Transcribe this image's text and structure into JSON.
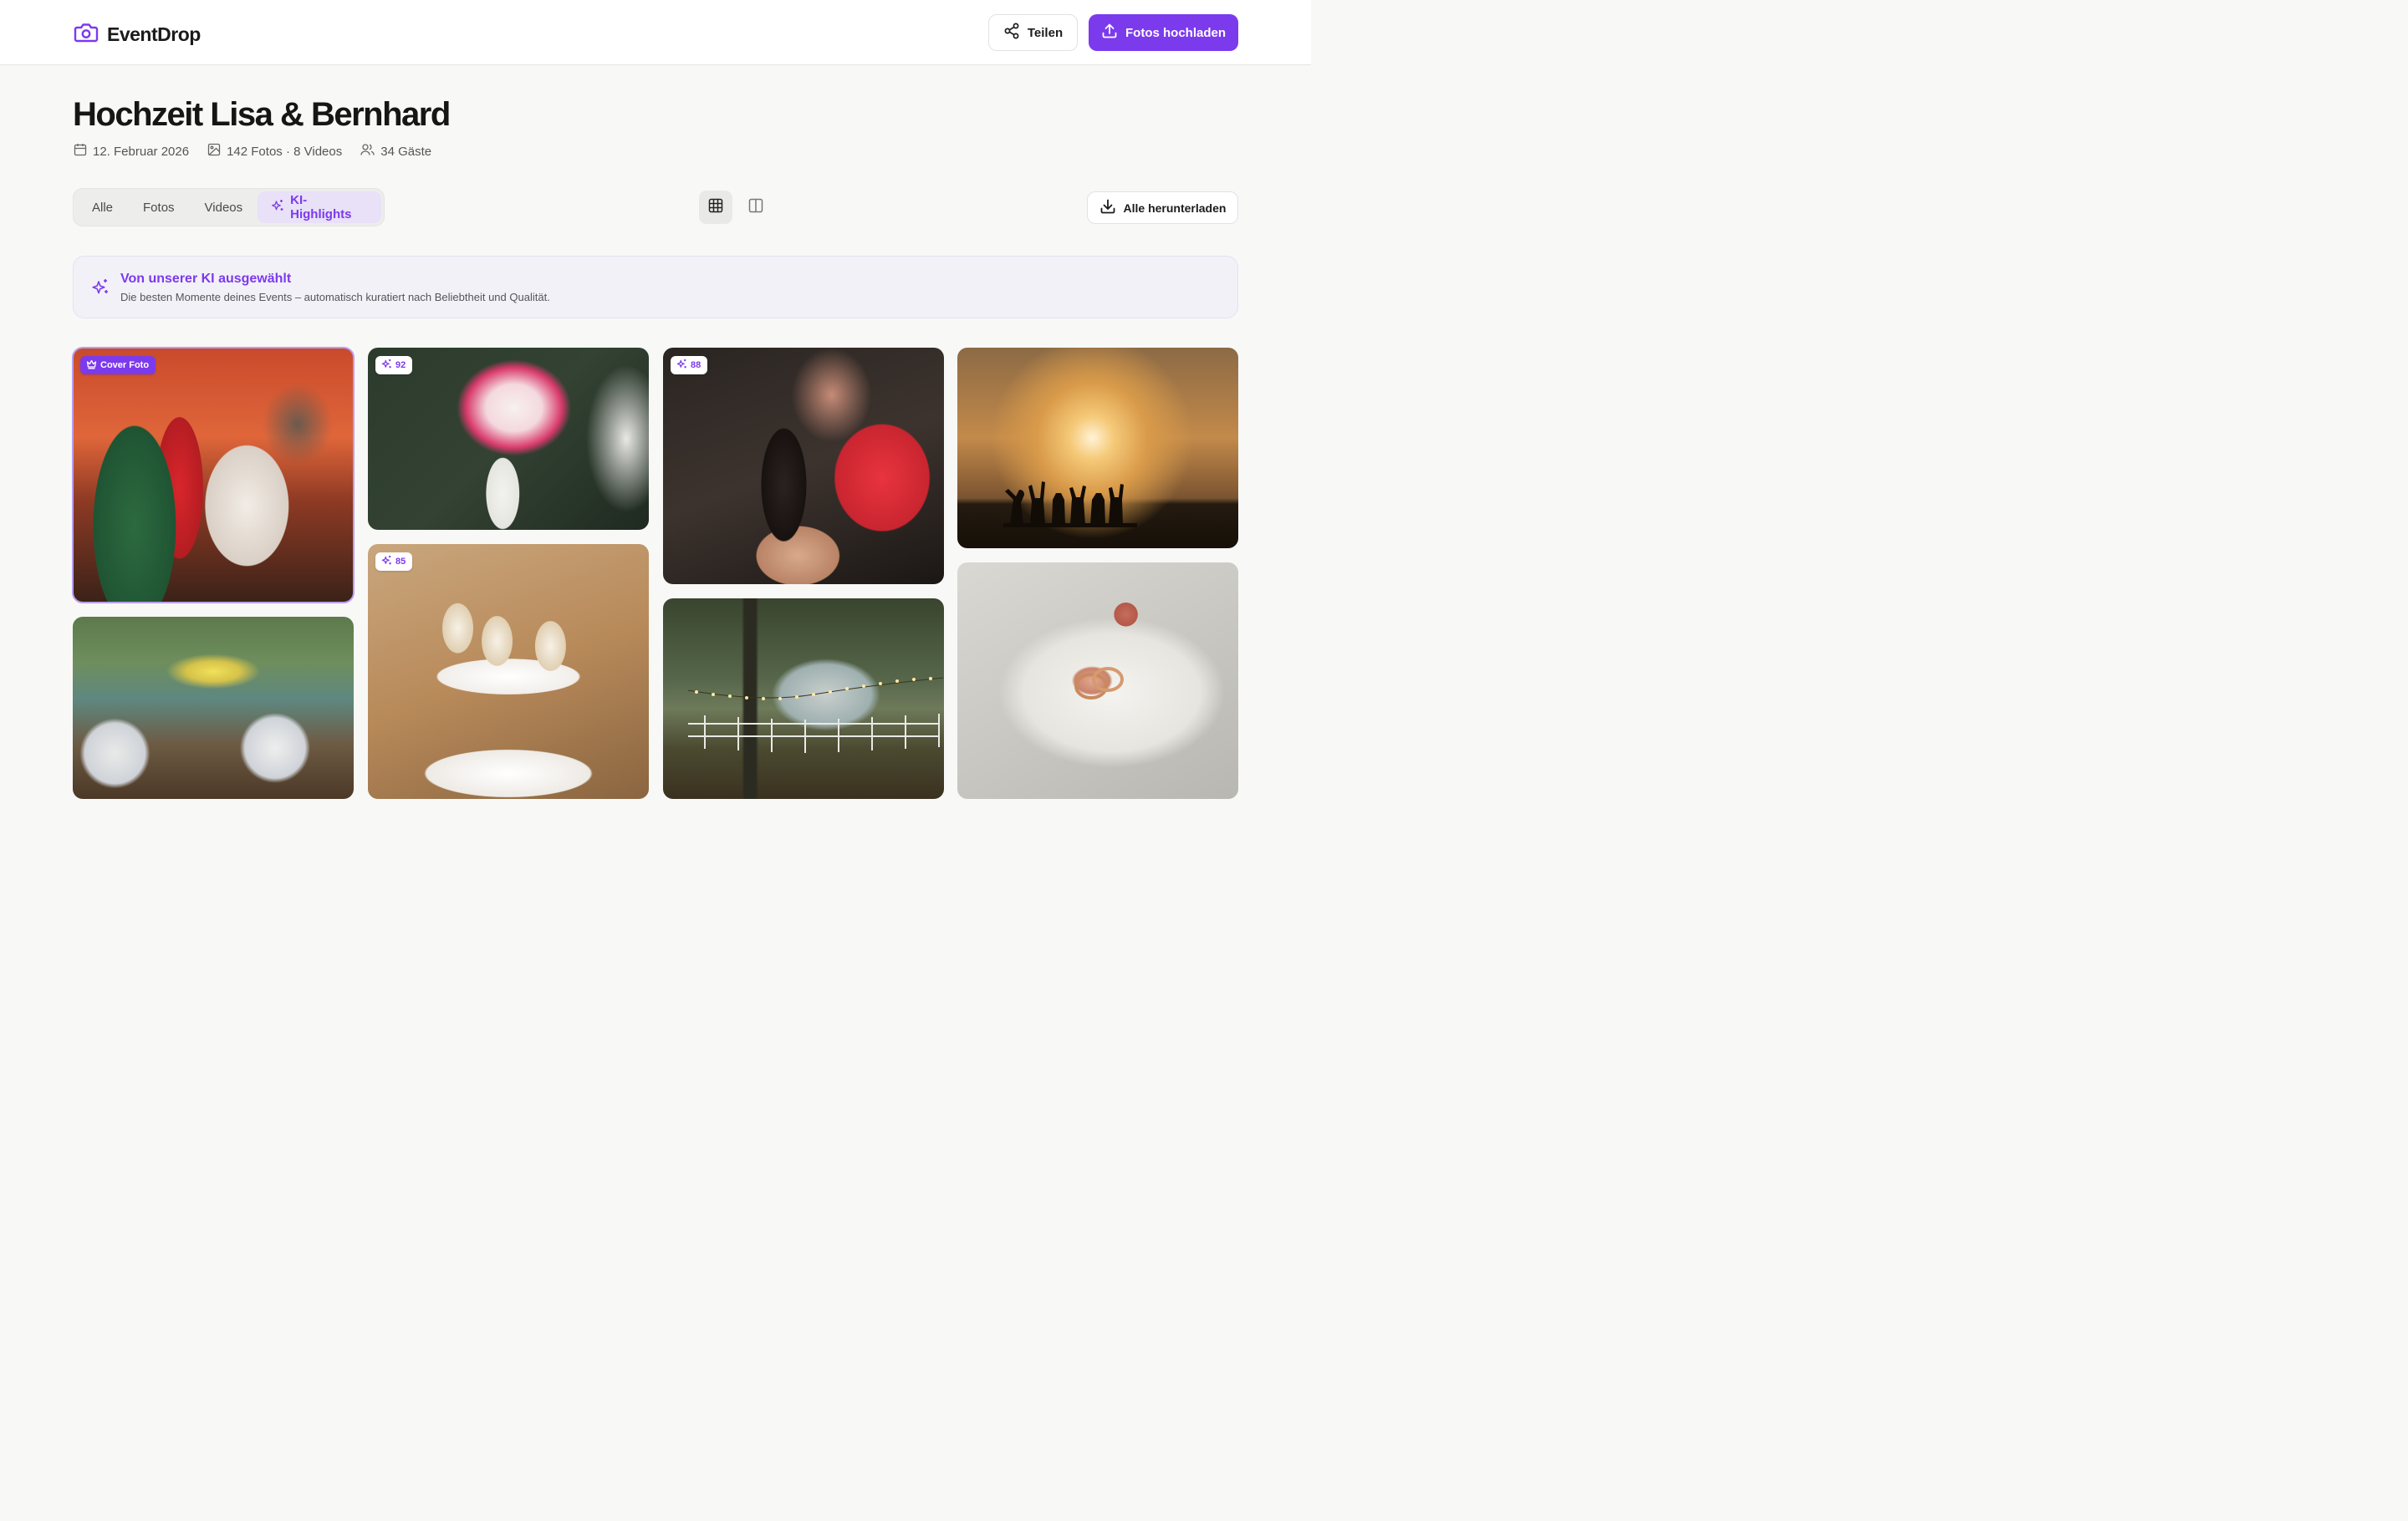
{
  "header": {
    "brand": "EventDrop",
    "share_label": "Teilen",
    "upload_label": "Fotos hochladen"
  },
  "event": {
    "title": "Hochzeit Lisa & Bernhard",
    "date": "12. Februar 2026",
    "media_count": "142 Fotos · 8 Videos",
    "guests": "34 Gäste"
  },
  "tabs": [
    {
      "label": "Alle",
      "active": false
    },
    {
      "label": "Fotos",
      "active": false
    },
    {
      "label": "Videos",
      "active": false
    },
    {
      "label": "KI-Highlights",
      "active": true
    }
  ],
  "view": {
    "selected": "grid"
  },
  "download_all_label": "Alle herunterladen",
  "banner": {
    "title": "Von unserer KI ausgewählt",
    "subtitle": "Die besten Momente deines Events – automatisch kuratiert nach Beliebtheit und Qualität."
  },
  "photos": [
    {
      "badge": "Cover Foto",
      "badge_type": "cover"
    },
    {
      "badge": "92",
      "badge_type": "score"
    },
    {
      "badge": "88",
      "badge_type": "score"
    },
    {
      "badge": "",
      "badge_type": "none"
    },
    {
      "badge": "",
      "badge_type": "none"
    },
    {
      "badge": "85",
      "badge_type": "score"
    },
    {
      "badge": "",
      "badge_type": "none"
    },
    {
      "badge": "",
      "badge_type": "none"
    }
  ],
  "colors": {
    "accent": "#7c3aed",
    "background": "#f8f8f7"
  }
}
